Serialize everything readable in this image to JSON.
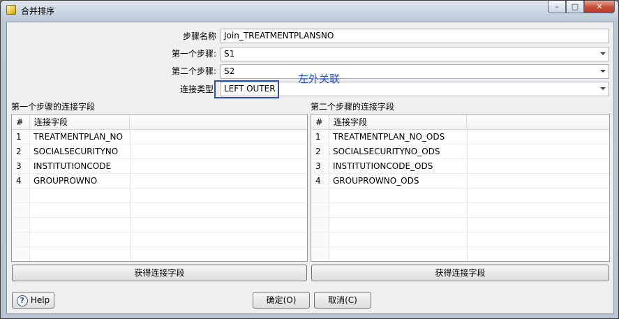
{
  "window": {
    "title": "合并排序",
    "buttons": {
      "minimize": "–",
      "maximize": "□",
      "close": "✕"
    }
  },
  "form": {
    "step_name_label": "步骤名称",
    "step_name_value": "Join_TREATMENTPLANSNO",
    "first_step_label": "第一个步骤:",
    "first_step_value": "S1",
    "second_step_label": "第二个步骤:",
    "second_step_value": "S2",
    "join_type_label": "连接类型:",
    "join_type_value": "LEFT OUTER",
    "annotation": "左外关联"
  },
  "left_grid": {
    "label": "第一个步骤的连接字段",
    "headers": {
      "num": "#",
      "field": "连接字段"
    },
    "rows": [
      {
        "num": "1",
        "field": "TREATMENTPLAN_NO"
      },
      {
        "num": "2",
        "field": "SOCIALSECURITYNO"
      },
      {
        "num": "3",
        "field": "INSTITUTIONCODE"
      },
      {
        "num": "4",
        "field": "GROUPROWNO"
      }
    ],
    "button": "获得连接字段"
  },
  "right_grid": {
    "label": "第二个步骤的连接字段",
    "headers": {
      "num": "#",
      "field": "连接字段"
    },
    "rows": [
      {
        "num": "1",
        "field": "TREATMENTPLAN_NO_ODS"
      },
      {
        "num": "2",
        "field": "SOCIALSECURITYNO_ODS"
      },
      {
        "num": "3",
        "field": "INSTITUTIONCODE_ODS"
      },
      {
        "num": "4",
        "field": "GROUPROWNO_ODS"
      }
    ],
    "button": "获得连接字段"
  },
  "footer": {
    "help_icon": "?",
    "help": "Help",
    "ok": "确定(O)",
    "cancel": "取消(C)"
  }
}
